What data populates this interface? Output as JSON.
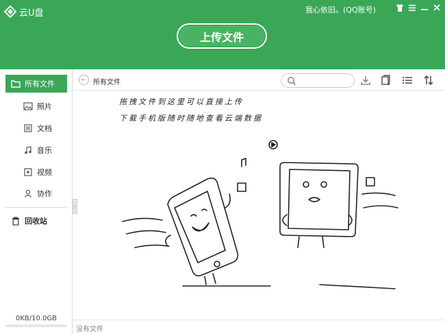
{
  "header": {
    "app_title": "云U盘",
    "user": "我心依旧。(QQ账号)",
    "upload_label": "上传文件"
  },
  "sidebar": {
    "items": [
      {
        "label": "所有文件",
        "icon": "folder-icon",
        "active": true
      },
      {
        "label": "照片",
        "icon": "image-icon"
      },
      {
        "label": "文档",
        "icon": "document-icon"
      },
      {
        "label": "音乐",
        "icon": "music-icon"
      },
      {
        "label": "视频",
        "icon": "video-icon"
      },
      {
        "label": "协作",
        "icon": "person-icon"
      }
    ],
    "trash_label": "回收站",
    "storage": "0KB/10.0GB",
    "storage_used_fraction": 0
  },
  "toolbar": {
    "breadcrumb": "所有文件",
    "search_placeholder": ""
  },
  "content": {
    "hint_line1": "拖拽文件到这里可以直接上传",
    "hint_line2": "下载手机版随时随地查看云端数据"
  },
  "status": {
    "text": "没有文件"
  },
  "colors": {
    "brand_green": "#3aa757"
  }
}
